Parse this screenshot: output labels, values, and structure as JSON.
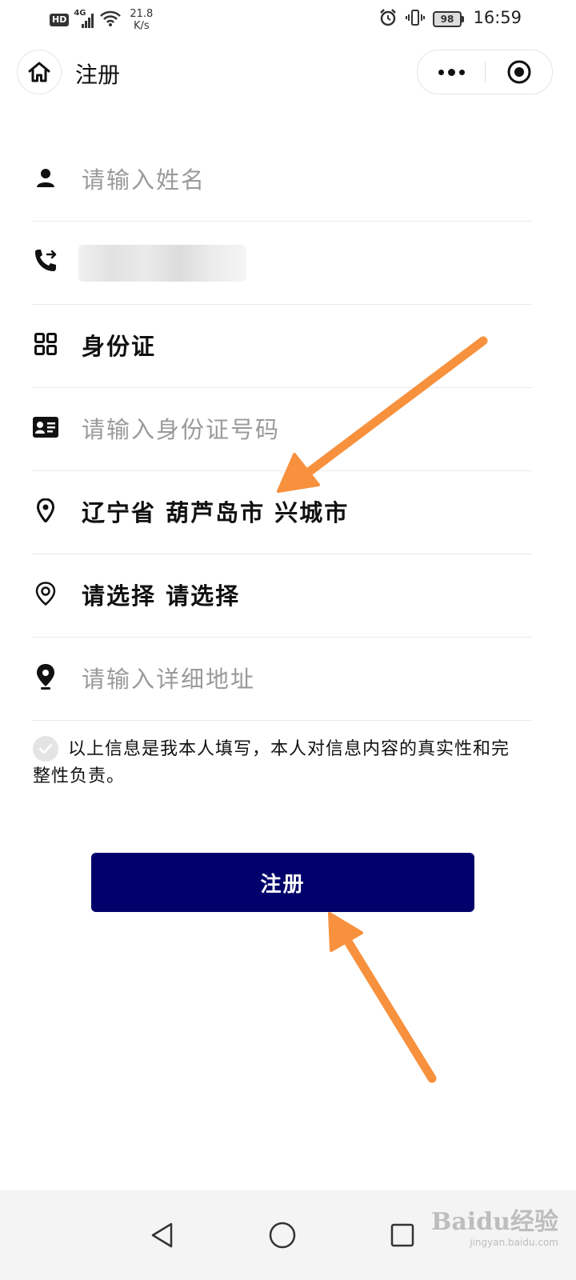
{
  "status_bar": {
    "hd": "HD",
    "network": "4G",
    "speed_value": "21.8",
    "speed_unit": "K/s",
    "battery": "98",
    "time": "16:59"
  },
  "title_bar": {
    "title": "注册"
  },
  "form": {
    "name_placeholder": "请输入姓名",
    "id_type": "身份证",
    "id_number_placeholder": "请输入身份证号码",
    "region": "辽宁省 葫芦岛市 兴城市",
    "secondary_select": "请选择 请选择",
    "address_placeholder": "请输入详细地址"
  },
  "agreement": {
    "text": "以上信息是我本人填写，本人对信息内容的真实性和完整性负责。"
  },
  "register_button": {
    "label": "注册"
  },
  "watermark": {
    "main": "Baidu经验",
    "sub": "jingyan.baidu.com"
  },
  "colors": {
    "primary": "#02006b",
    "arrow": "#f7913d",
    "placeholder": "#9a9a9a"
  }
}
